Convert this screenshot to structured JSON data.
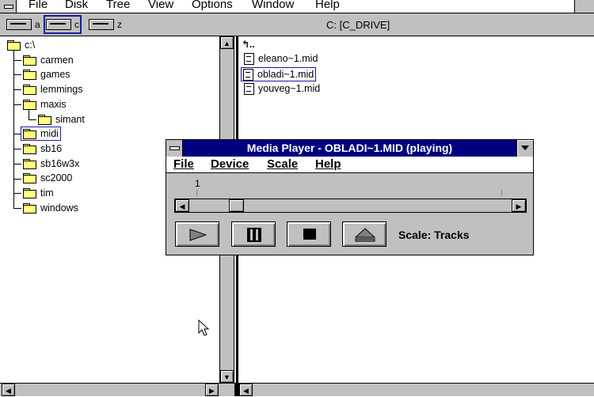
{
  "menubar": {
    "items": [
      {
        "label": "File"
      },
      {
        "label": "Disk"
      },
      {
        "label": "Tree"
      },
      {
        "label": "View"
      },
      {
        "label": "Options"
      },
      {
        "label": "Window"
      },
      {
        "label": "Help"
      }
    ]
  },
  "drives": [
    {
      "letter": "a",
      "icon": "floppy-drive-icon"
    },
    {
      "letter": "c",
      "icon": "hard-drive-icon",
      "selected": true
    },
    {
      "letter": "z",
      "icon": "network-drive-icon"
    }
  ],
  "path_label": "C: [C_DRIVE]",
  "tree": {
    "root": "c:\\",
    "items": [
      {
        "label": "carmen"
      },
      {
        "label": "games"
      },
      {
        "label": "lemmings"
      },
      {
        "label": "maxis"
      },
      {
        "label": "simant"
      },
      {
        "label": "midi",
        "selected": true
      },
      {
        "label": "sb16"
      },
      {
        "label": "sb16w3x"
      },
      {
        "label": "sc2000"
      },
      {
        "label": "tim"
      },
      {
        "label": "windows"
      }
    ]
  },
  "files": {
    "up_icon": "up-folder-icon",
    "items": [
      {
        "label": "eleano~1.mid"
      },
      {
        "label": "obladi~1.mid",
        "selected": true
      },
      {
        "label": "youveg~1.mid"
      }
    ]
  },
  "media_player": {
    "title": "Media Player - OBLADI~1.MID (playing)",
    "menu": [
      {
        "label": "File"
      },
      {
        "label": "Device"
      },
      {
        "label": "Scale"
      },
      {
        "label": "Help"
      }
    ],
    "track_label": "1",
    "position_fraction": 0.13,
    "buttons": [
      "play-icon",
      "pause-icon",
      "stop-icon",
      "eject-icon"
    ],
    "scale_text": "Scale: Tracks"
  },
  "colors": {
    "title_bar": "#000080",
    "face": "#c0c0c0",
    "folder": "#ffff80",
    "selection": "#1a1aa0"
  }
}
